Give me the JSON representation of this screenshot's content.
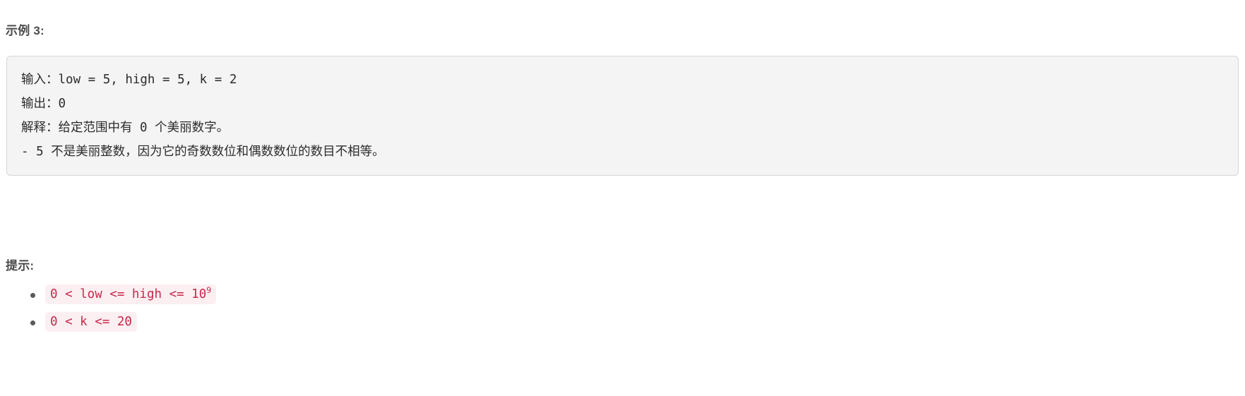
{
  "example": {
    "heading": "示例 3:",
    "code_lines": [
      "输入：low = 5, high = 5, k = 2",
      "输出：0",
      "解释：给定范围中有 0 个美丽数字。",
      "- 5 不是美丽整数，因为它的奇数数位和偶数数位的数目不相等。"
    ]
  },
  "hints": {
    "heading": "提示:",
    "items": [
      {
        "prefix": "0 < low <= high <= 10",
        "exponent": "9"
      },
      {
        "prefix": "0 < k <= 20",
        "exponent": ""
      }
    ]
  },
  "colors": {
    "heading_text": "#4b4b4b",
    "code_block_bg": "#f4f4f4",
    "code_block_border": "#d6d6d6",
    "code_text": "#2b2b2b",
    "inline_code_text": "#c9284a",
    "inline_code_bg": "#fbeff2",
    "bullet": "#585858",
    "page_bg": "#ffffff"
  }
}
